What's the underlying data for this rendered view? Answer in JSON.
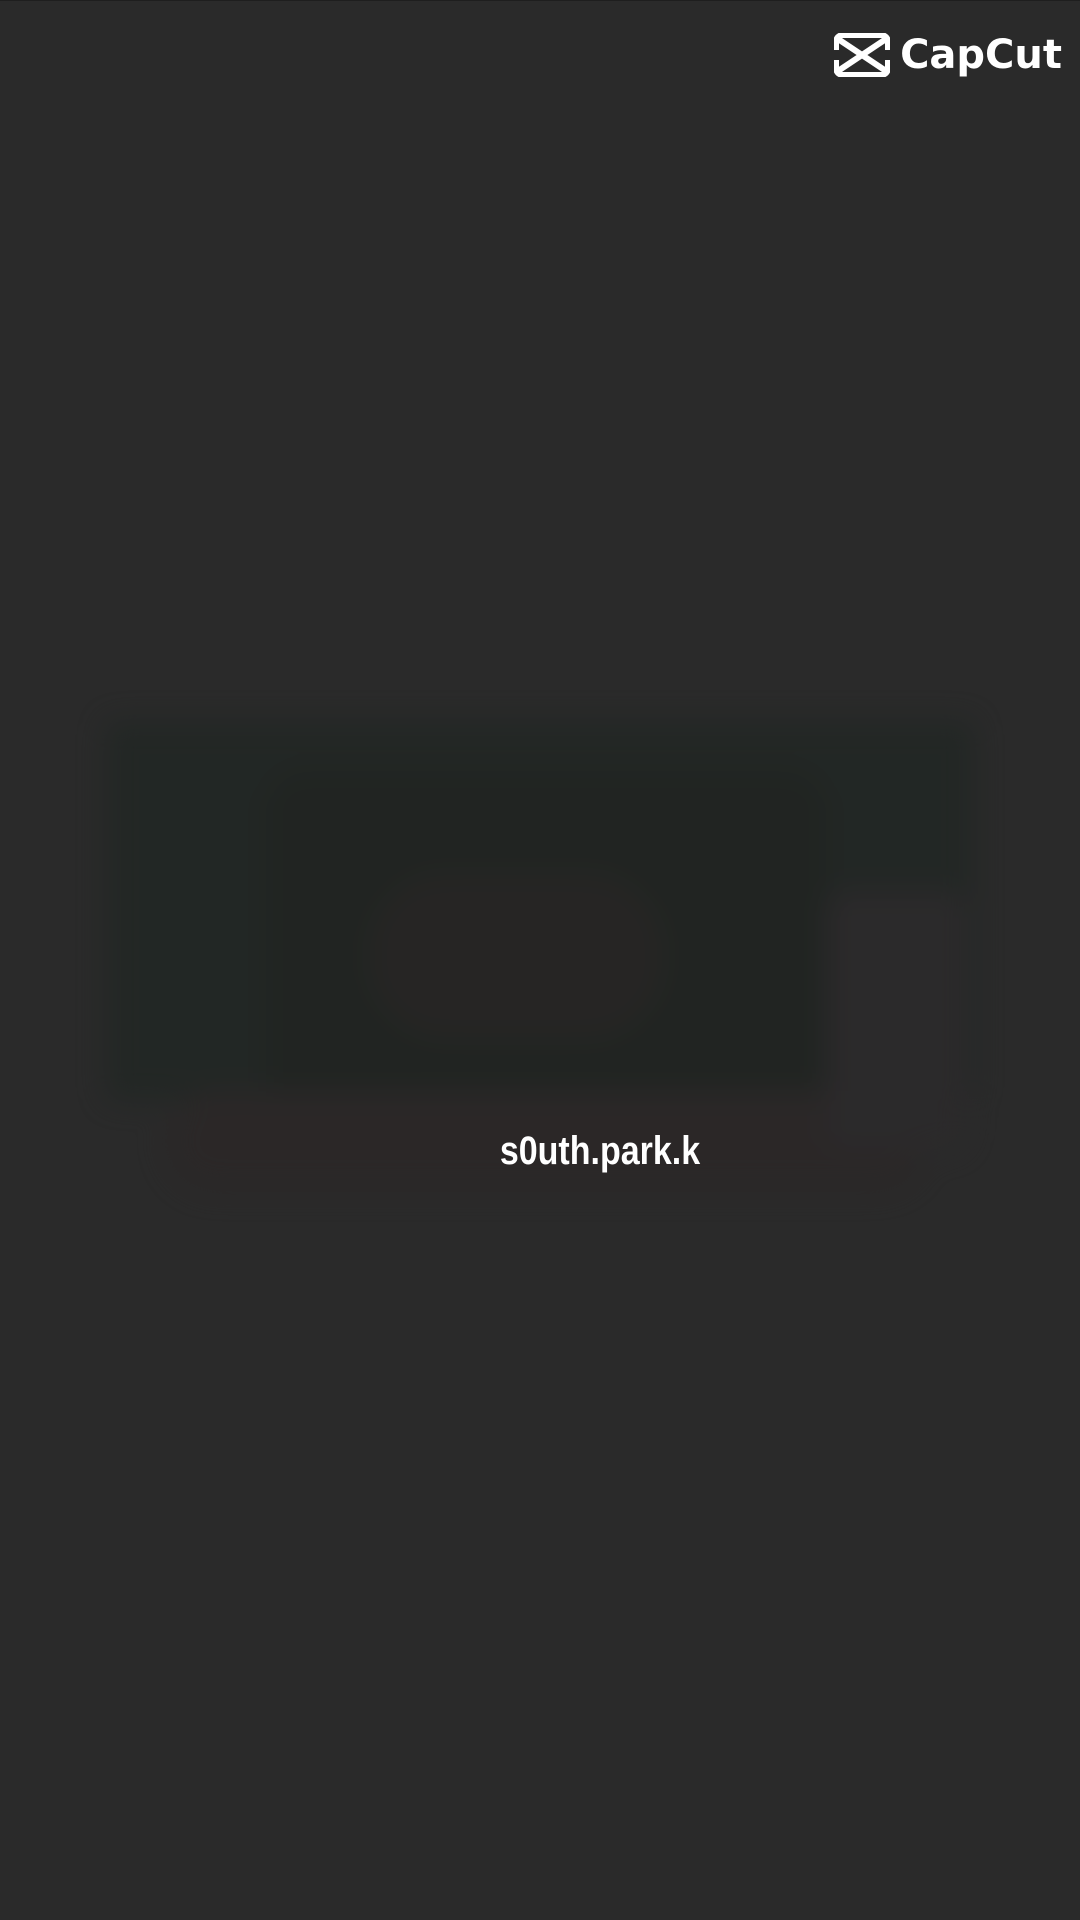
{
  "watermark": {
    "brand": "CapCut",
    "icon": "capcut-logo-icon",
    "color": "#ffffff"
  },
  "caption": {
    "text": "s0uth.park.k"
  },
  "colors": {
    "background": "#2a2a2a",
    "caption": "#ffffff"
  }
}
